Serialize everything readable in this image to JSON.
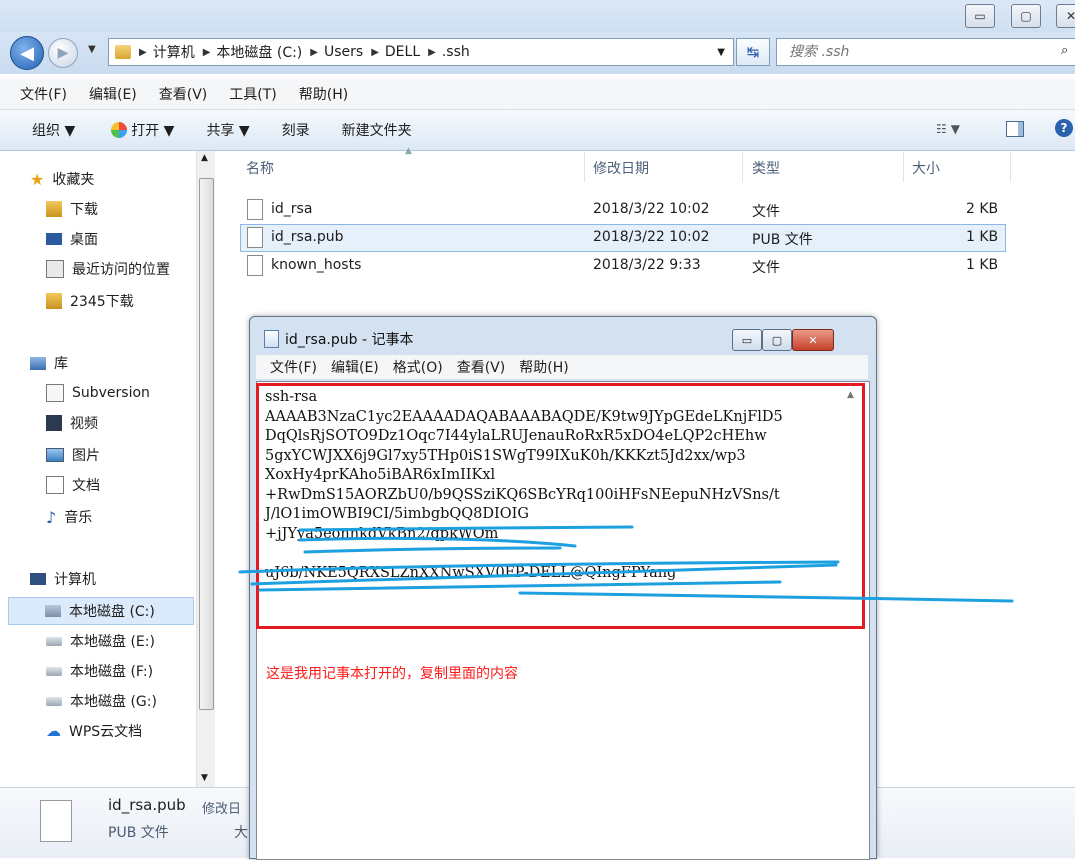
{
  "address": {
    "crumbs": [
      "计算机",
      "本地磁盘 (C:)",
      "Users",
      "DELL",
      ".ssh"
    ],
    "search_placeholder": "搜索 .ssh"
  },
  "menubar": [
    "文件(F)",
    "编辑(E)",
    "查看(V)",
    "工具(T)",
    "帮助(H)"
  ],
  "toolbar": {
    "organize": "组织 ▼",
    "open": "打开 ▼",
    "share": "共享 ▼",
    "burn": "刻录",
    "new_folder": "新建文件夹"
  },
  "nav": {
    "favorites": "收藏夹",
    "downloads": "下载",
    "desktop": "桌面",
    "recent": "最近访问的位置",
    "dl2345": "2345下载",
    "libraries": "库",
    "subversion": "Subversion",
    "videos": "视频",
    "pictures": "图片",
    "documents": "文档",
    "music": "音乐",
    "computer": "计算机",
    "drive_c": "本地磁盘 (C:)",
    "drive_e": "本地磁盘 (E:)",
    "drive_f": "本地磁盘 (F:)",
    "drive_g": "本地磁盘 (G:)",
    "wps": "WPS云文档"
  },
  "columns": [
    "名称",
    "修改日期",
    "类型",
    "大小"
  ],
  "files": [
    {
      "name": "id_rsa",
      "date": "2018/3/22 10:02",
      "type": "文件",
      "size": "2 KB"
    },
    {
      "name": "id_rsa.pub",
      "date": "2018/3/22 10:02",
      "type": "PUB 文件",
      "size": "1 KB"
    },
    {
      "name": "known_hosts",
      "date": "2018/3/22 9:33",
      "type": "文件",
      "size": "1 KB"
    }
  ],
  "details": {
    "name": "id_rsa.pub",
    "modified_label": "修改日",
    "type": "PUB 文件",
    "size_label": "大"
  },
  "notepad": {
    "title": "id_rsa.pub - 记事本",
    "menu": [
      "文件(F)",
      "编辑(E)",
      "格式(O)",
      "查看(V)",
      "帮助(H)"
    ],
    "content": "ssh-rsa\nAAAAB3NzaC1yc2EAAAADAQABAAABAQDE/K9tw9JYpGEdeLKnjFlD5\nDqQlsRjSOTO9Dz1Oqc7I44ylaLRUJenauRoRxR5xDO4eLQP2cHEhw\n5gxYCWJXX6j9Gl7xy5THp0iS1SWgT99IXuK0h/KKKzt5Jd2xx/wp3\nXoxHy4prKAho5iBAR6xImIIKxl\n+RwDmS15AORZbU0/b9QSSziKQ6SBcYRq100iHFsNEepuNHzVSns/t\nJ/lO1imOWBI9CI/5imbgbQQ8DIOIG\n+jJYya5eonnkdVkBn2/qpkWOm\n\nuJ6b/NKE5QRXSLZnXXNwSXV0FP-DELL@QIngFPYang"
  },
  "annotation": "这是我用记事本打开的，复制里面的内容"
}
